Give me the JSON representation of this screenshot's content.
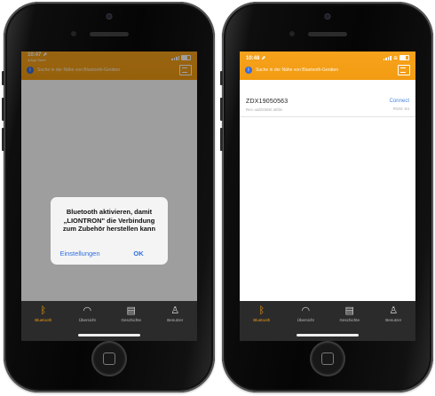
{
  "phone_left": {
    "status_time": "10:47 ⬈",
    "status_sub": "◂ App Store",
    "scan_text": "Suche in der Nähe von Bluetooth-Geräten",
    "dialog": {
      "message": "Bluetooth aktivieren, damit „LIONTRON\" die Verbindung zum Zubehör herstellen kann",
      "button_settings": "Einstellungen",
      "button_ok": "OK"
    },
    "tabs": [
      "Bluetooth",
      "Übersicht",
      "Geschichte",
      "Benutzer"
    ]
  },
  "phone_right": {
    "status_time": "10:48 ⬈",
    "scan_text": "Suche in der Nähe von Bluetooth-Geräten",
    "device": {
      "name": "ZDX19050563",
      "subtitle": "Rec·ualt/2565/ a5f3c",
      "action": "Connect",
      "rssi": "RSSI:-84"
    },
    "tabs": [
      "Bluetooth",
      "Übersicht",
      "Geschichte",
      "Benutzer"
    ]
  },
  "icons": [
    "bluetooth-icon",
    "gauge-icon",
    "history-icon",
    "user-icon",
    "qr-scan-icon"
  ],
  "colors": {
    "accent": "#f39c12",
    "link": "#2f6fde",
    "tabbar": "#2b2b2b"
  }
}
